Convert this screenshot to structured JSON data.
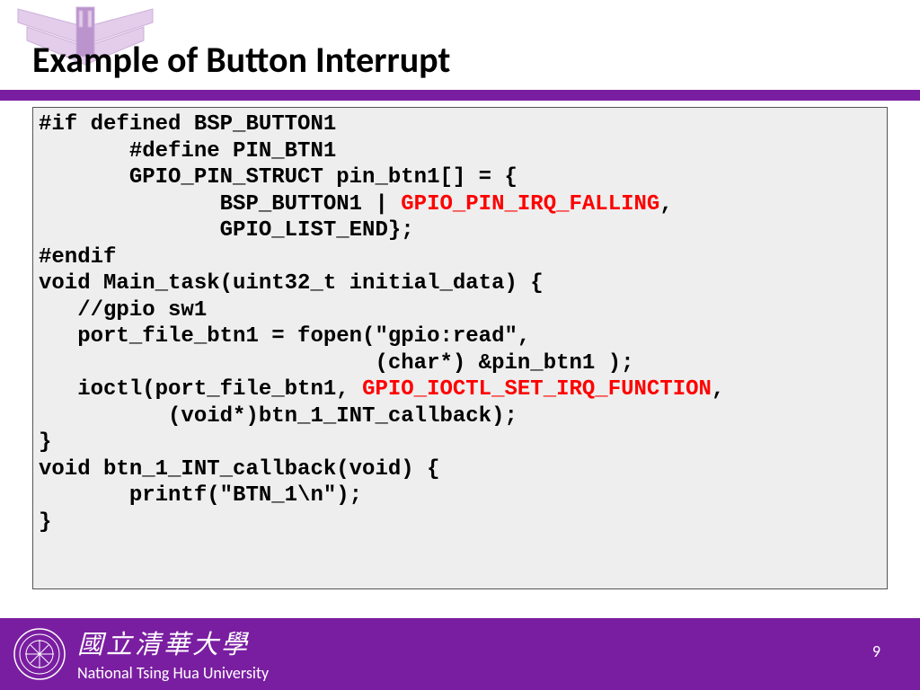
{
  "title": "Example of Button Interrupt",
  "code": {
    "l1": "#if defined BSP_BUTTON1",
    "l2": "       #define PIN_BTN1",
    "l3": "       GPIO_PIN_STRUCT pin_btn1[] = {",
    "l4a": "              BSP_BUTTON1 | ",
    "l4b": "GPIO_PIN_IRQ_FALLING",
    "l4c": ",",
    "l5": "              GPIO_LIST_END};",
    "l6": "#endif",
    "l7": "void Main_task(uint32_t initial_data) {",
    "l8": "   //gpio sw1",
    "l9": "   port_file_btn1 = fopen(\"gpio:read\",",
    "l10": "                          (char*) &pin_btn1 );",
    "l11a": "   ioctl(port_file_btn1, ",
    "l11b": "GPIO_IOCTL_SET_IRQ_FUNCTION",
    "l11c": ",",
    "l12": "          (void*)btn_1_INT_callback);",
    "l13": "}",
    "l14": "void btn_1_INT_callback(void) {",
    "l15": "       printf(\"BTN_1\\n\");",
    "l16": "}"
  },
  "footer": {
    "cn": "國立清華大學",
    "en": "National Tsing Hua University"
  },
  "page": "9"
}
